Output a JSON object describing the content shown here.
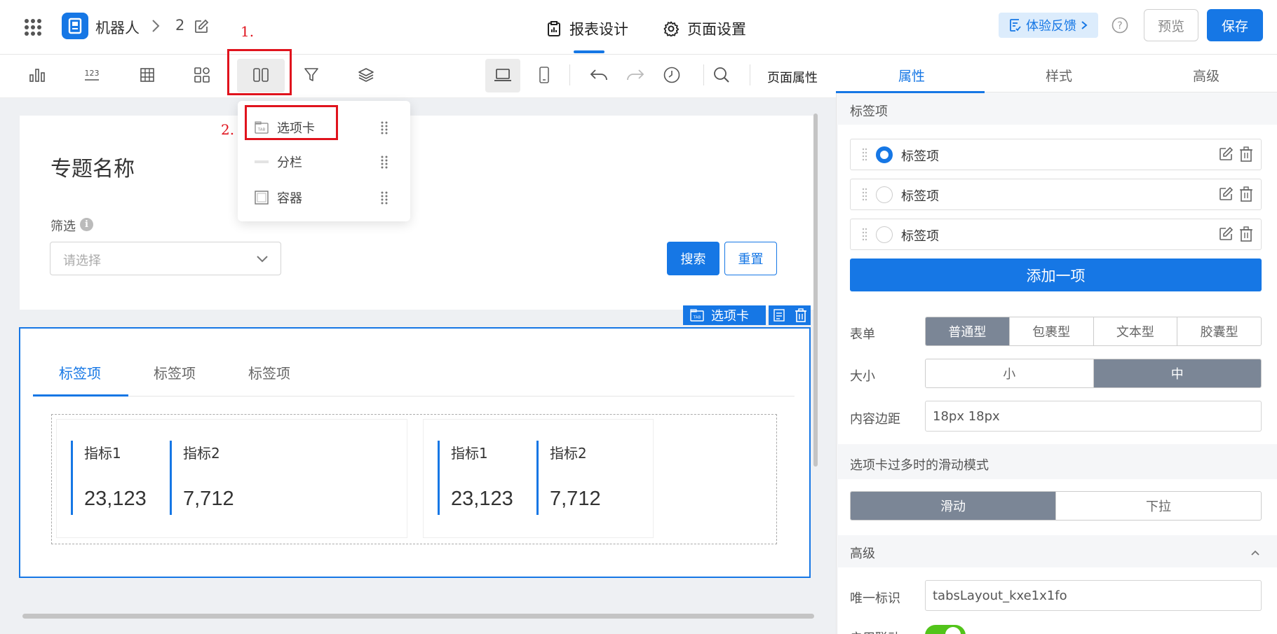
{
  "header": {
    "app_name": "机器人",
    "page_number": "2",
    "tab_design": "报表设计",
    "tab_page_settings": "页面设置",
    "feedback": "体验反馈",
    "preview": "预览",
    "save": "保存"
  },
  "toolbar": {
    "items": [
      "bar-chart",
      "metric-123",
      "table",
      "grid-layout",
      "columns-layout",
      "filter",
      "layers"
    ],
    "page_props": "页面属性"
  },
  "popup": {
    "items": [
      {
        "label": "选项卡",
        "icon": "tab-icon"
      },
      {
        "label": "分栏",
        "icon": "divider-icon"
      },
      {
        "label": "容器",
        "icon": "container-icon"
      }
    ]
  },
  "annotations": {
    "step1": "1.",
    "step2": "2."
  },
  "canvas": {
    "topic_title": "专题名称",
    "filter_label": "筛选",
    "filter_info": "i",
    "filter_placeholder": "请选择",
    "search": "搜索",
    "reset": "重置",
    "selected_badge": "选项卡",
    "tabs": [
      "标签项",
      "标签项",
      "标签项"
    ],
    "metrics_left": [
      {
        "name": "指标1",
        "value": "23,123"
      },
      {
        "name": "指标2",
        "value": "7,712"
      }
    ],
    "metrics_right": [
      {
        "name": "指标1",
        "value": "23,123"
      },
      {
        "name": "指标2",
        "value": "7,712"
      }
    ]
  },
  "panel": {
    "tabs": [
      "属性",
      "样式",
      "高级"
    ],
    "sec_tab_items": "标签项",
    "tab_items": [
      {
        "label": "标签项",
        "selected": true
      },
      {
        "label": "标签项",
        "selected": false
      },
      {
        "label": "标签项",
        "selected": false
      }
    ],
    "add_item": "添加一项",
    "form_label": "表单",
    "form_options": [
      "普通型",
      "包裹型",
      "文本型",
      "胶囊型"
    ],
    "size_label": "大小",
    "size_options": [
      "小",
      "中"
    ],
    "padding_label": "内容边距",
    "padding_value": "18px 18px",
    "scroll_mode_title": "选项卡过多时的滑动模式",
    "scroll_options": [
      "滑动",
      "下拉"
    ],
    "advanced_title": "高级",
    "uid_label": "唯一标识",
    "uid_value": "tabsLayout_kxe1x1fo",
    "enable_label": "启用联动"
  },
  "colors": {
    "primary": "#1677e5",
    "annotation": "#e0131d",
    "segment_active": "#7b8696",
    "toggle_on": "#52c41a"
  }
}
